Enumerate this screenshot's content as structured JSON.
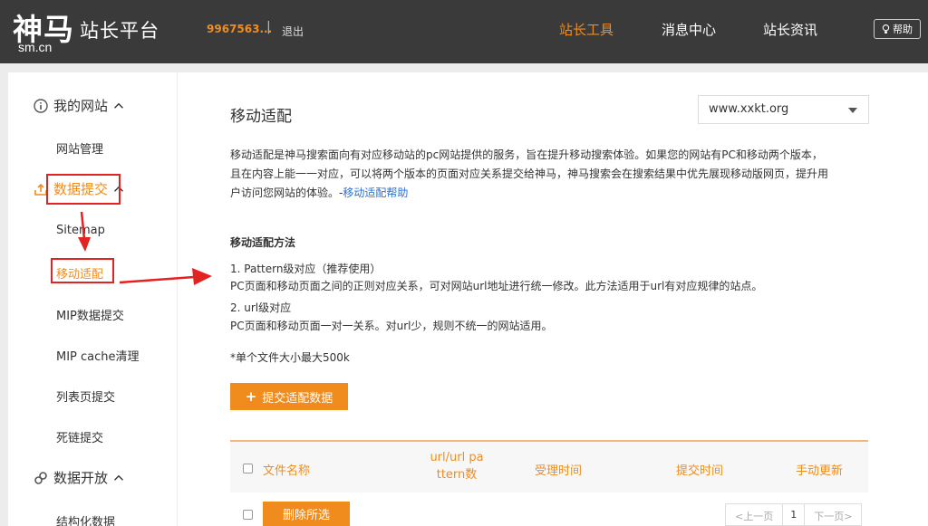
{
  "header": {
    "logo_glyph": "神马",
    "logo_sub": "sm.cn",
    "logo_platform": "站长平台",
    "user_id": "9967563...",
    "separator": "|",
    "logout": "退出",
    "nav": [
      "站长工具",
      "消息中心",
      "站长资讯"
    ],
    "help": "帮助"
  },
  "sidebar": {
    "section_my_sites": "我的网站",
    "site_manage": "网站管理",
    "section_data_submit": "数据提交",
    "sitemap": "Sitemap",
    "mobile_adapt": "移动适配",
    "mip_submit": "MIP数据提交",
    "mip_cache": "MIP cache清理",
    "list_submit": "列表页提交",
    "dead_link": "死链提交",
    "section_data_open": "数据开放",
    "structured": "结构化数据"
  },
  "main": {
    "title": "移动适配",
    "site": "www.xxkt.org",
    "desc_lines": [
      "移动适配是神马搜索面向有对应移动站的pc网站提供的服务，旨在提升移动搜索体验。如果您的网站有PC和移动两个版本，",
      "且在内容上能一一对应，可以将两个版本的页面对应关系提交给神马，神马搜索会在搜索结果中优先展现移动版网页，提升用",
      "户访问您网站的体验。-"
    ],
    "desc_link": "移动适配帮助",
    "method_title": "移动适配方法",
    "m1_title": "1. Pattern级对应（推荐使用）",
    "m1_desc": "PC页面和移动页面之间的正则对应关系，可对网站url地址进行统一修改。此方法适用于url有对应规律的站点。",
    "m2_title": "2. url级对应",
    "m2_desc": "PC页面和移动页面一对一关系。对url少，规则不统一的网站适用。",
    "size_note": "*单个文件大小最大500k",
    "submit_btn": "提交适配数据",
    "table_headers": {
      "filename": "文件名称",
      "url_pattern_1": "url/url pa",
      "url_pattern_2": "ttern数",
      "accept_time": "受理时间",
      "submit_time": "提交时间",
      "manual_update": "手动更新"
    },
    "delete_btn": "删除所选",
    "pager": {
      "prev": "<上一页",
      "current": "1",
      "next": "下一页>"
    }
  },
  "colors": {
    "accent": "#f08c1e",
    "header_bg": "#3a3a3a",
    "link": "#2a6fd8",
    "annotation": "#e32222"
  }
}
